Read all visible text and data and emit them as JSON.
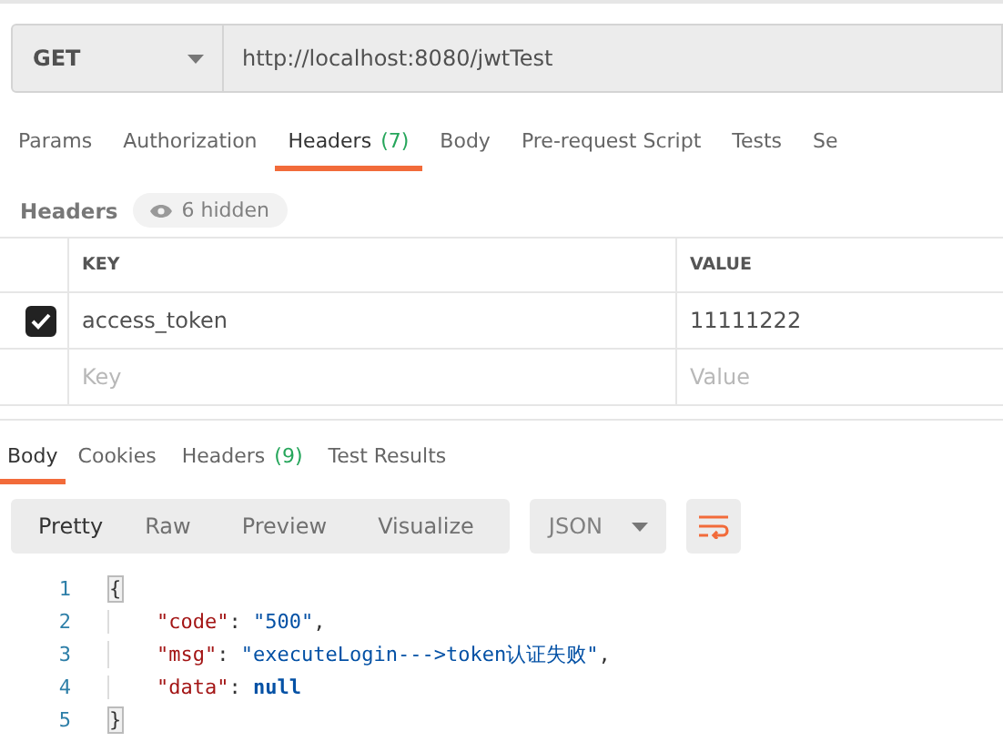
{
  "request": {
    "method": "GET",
    "url": "http://localhost:8080/jwtTest"
  },
  "request_tabs": [
    {
      "label": "Params",
      "selected": false
    },
    {
      "label": "Authorization",
      "selected": false
    },
    {
      "label": "Headers",
      "count": "(7)",
      "selected": true
    },
    {
      "label": "Body",
      "selected": false
    },
    {
      "label": "Pre-request Script",
      "selected": false
    },
    {
      "label": "Tests",
      "selected": false
    },
    {
      "label": "Se",
      "selected": false
    }
  ],
  "headers_bar": {
    "title": "Headers",
    "hidden_toggle": "6 hidden"
  },
  "headers_table": {
    "columns": [
      "KEY",
      "VALUE"
    ],
    "rows": [
      {
        "key": "access_token",
        "value": "11111222",
        "checked": true
      }
    ],
    "new_row": {
      "key_placeholder": "Key",
      "value_placeholder": "Value"
    }
  },
  "response_tabs": [
    {
      "label": "Body",
      "selected": true
    },
    {
      "label": "Cookies",
      "selected": false
    },
    {
      "label": "Headers",
      "count": "(9)",
      "selected": false
    },
    {
      "label": "Test Results",
      "selected": false
    }
  ],
  "view_modes": [
    {
      "label": "Pretty",
      "selected": true
    },
    {
      "label": "Raw",
      "selected": false
    },
    {
      "label": "Preview",
      "selected": false
    },
    {
      "label": "Visualize",
      "selected": false
    }
  ],
  "format": "JSON",
  "code_lines": [
    {
      "number": "1",
      "tokens": [
        {
          "kind": "bracket",
          "text": "{"
        }
      ]
    },
    {
      "number": "2",
      "tokens": [
        {
          "kind": "key",
          "text": "\"code\""
        },
        {
          "kind": "punct",
          "text": ": "
        },
        {
          "kind": "string",
          "text": "\"500\""
        },
        {
          "kind": "punct",
          "text": ","
        }
      ]
    },
    {
      "number": "3",
      "tokens": [
        {
          "kind": "key",
          "text": "\"msg\""
        },
        {
          "kind": "punct",
          "text": ": "
        },
        {
          "kind": "string",
          "text": "\"executeLogin--->token认证失败\""
        },
        {
          "kind": "punct",
          "text": ","
        }
      ]
    },
    {
      "number": "4",
      "tokens": [
        {
          "kind": "key",
          "text": "\"data\""
        },
        {
          "kind": "punct",
          "text": ": "
        },
        {
          "kind": "keyword",
          "text": "null"
        }
      ]
    },
    {
      "number": "5",
      "tokens": [
        {
          "kind": "bracket",
          "text": "}"
        }
      ]
    }
  ]
}
